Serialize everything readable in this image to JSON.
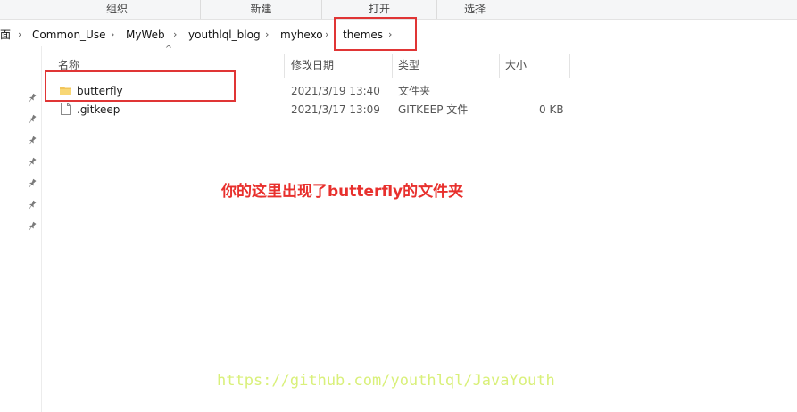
{
  "ribbon": {
    "groups": [
      "组织",
      "新建",
      "打开",
      "选择"
    ]
  },
  "breadcrumb": {
    "items": [
      "面",
      "Common_Use",
      "MyWeb",
      "youthlql_blog",
      "myhexo",
      "themes"
    ]
  },
  "columns": {
    "name": "名称",
    "modified": "修改日期",
    "type": "类型",
    "size": "大小"
  },
  "files": [
    {
      "name": "butterfly",
      "modified": "2021/3/19 13:40",
      "type": "文件夹",
      "size": "",
      "icon": "folder-icon"
    },
    {
      "name": ".gitkeep",
      "modified": "2021/3/17 13:09",
      "type": "GITKEEP 文件",
      "size": "0 KB",
      "icon": "file-icon"
    }
  ],
  "annotation": "你的这里出现了butterfly的文件夹",
  "watermark": "https://github.com/youthlql/JavaYouth",
  "colors": {
    "highlight_box": "#e03535",
    "annotation_text": "#e8302d",
    "watermark_text": "#d9f07a",
    "folder": "#f2c55a"
  }
}
